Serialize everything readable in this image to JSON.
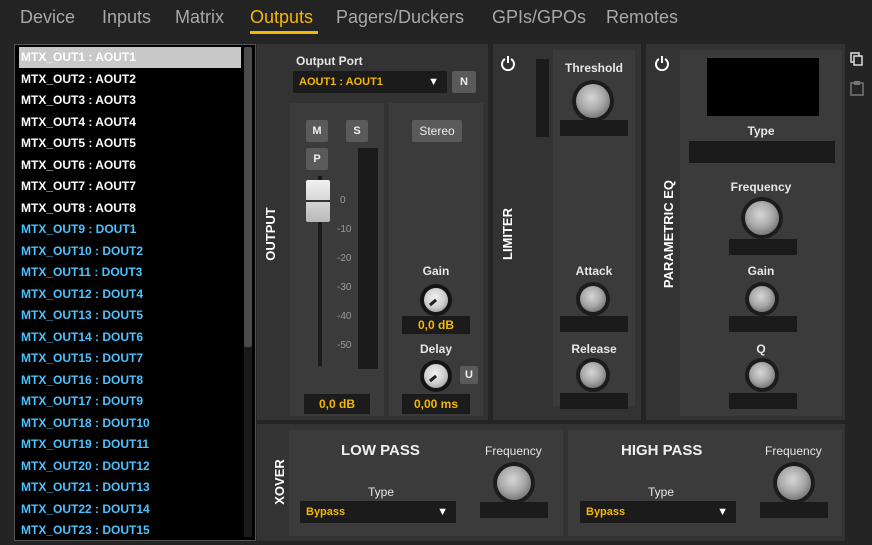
{
  "tabs": [
    {
      "label": "Device",
      "active": false
    },
    {
      "label": "Inputs",
      "active": false
    },
    {
      "label": "Matrix",
      "active": false
    },
    {
      "label": "Outputs",
      "active": true
    },
    {
      "label": "Pagers/Duckers",
      "active": false
    },
    {
      "label": "GPIs/GPOs",
      "active": false
    },
    {
      "label": "Remotes",
      "active": false
    }
  ],
  "colors": {
    "accent": "#f5b800",
    "digital": "#4cc2ff",
    "panel": "#333333"
  },
  "outputs": [
    {
      "label": "MTX_OUT1 : AOUT1",
      "kind": "analog",
      "selected": true
    },
    {
      "label": "MTX_OUT2 : AOUT2",
      "kind": "analog"
    },
    {
      "label": "MTX_OUT3 : AOUT3",
      "kind": "analog"
    },
    {
      "label": "MTX_OUT4 : AOUT4",
      "kind": "analog"
    },
    {
      "label": "MTX_OUT5 : AOUT5",
      "kind": "analog"
    },
    {
      "label": "MTX_OUT6 : AOUT6",
      "kind": "analog"
    },
    {
      "label": "MTX_OUT7 : AOUT7",
      "kind": "analog"
    },
    {
      "label": "MTX_OUT8 : AOUT8",
      "kind": "analog"
    },
    {
      "label": "MTX_OUT9 : DOUT1",
      "kind": "digital"
    },
    {
      "label": "MTX_OUT10 : DOUT2",
      "kind": "digital"
    },
    {
      "label": "MTX_OUT11 : DOUT3",
      "kind": "digital"
    },
    {
      "label": "MTX_OUT12 : DOUT4",
      "kind": "digital"
    },
    {
      "label": "MTX_OUT13 : DOUT5",
      "kind": "digital"
    },
    {
      "label": "MTX_OUT14 : DOUT6",
      "kind": "digital"
    },
    {
      "label": "MTX_OUT15 : DOUT7",
      "kind": "digital"
    },
    {
      "label": "MTX_OUT16 : DOUT8",
      "kind": "digital"
    },
    {
      "label": "MTX_OUT17 : DOUT9",
      "kind": "digital"
    },
    {
      "label": "MTX_OUT18 : DOUT10",
      "kind": "digital"
    },
    {
      "label": "MTX_OUT19 : DOUT11",
      "kind": "digital"
    },
    {
      "label": "MTX_OUT20 : DOUT12",
      "kind": "digital"
    },
    {
      "label": "MTX_OUT21 : DOUT13",
      "kind": "digital"
    },
    {
      "label": "MTX_OUT22 : DOUT14",
      "kind": "digital"
    },
    {
      "label": "MTX_OUT23 : DOUT15",
      "kind": "digital"
    }
  ],
  "output": {
    "section_label": "OUTPUT",
    "port_label": "Output Port",
    "port_value": "AOUT1 : AOUT1",
    "n_button": "N",
    "mute_button": "M",
    "solo_button": "S",
    "polarity_button": "P",
    "stereo_button": "Stereo",
    "fader_ticks": [
      "0",
      "-10",
      "-20",
      "-30",
      "-40",
      "-50"
    ],
    "fader_value": "0,0 dB",
    "gain_label": "Gain",
    "gain_value": "0,0 dB",
    "delay_label": "Delay",
    "delay_value": "0,00 ms",
    "u_button": "U"
  },
  "limiter": {
    "section_label": "LIMITER",
    "threshold_label": "Threshold",
    "attack_label": "Attack",
    "release_label": "Release"
  },
  "peq": {
    "section_label": "PARAMETRIC EQ",
    "type_label": "Type",
    "frequency_label": "Frequency",
    "gain_label": "Gain",
    "q_label": "Q"
  },
  "xover": {
    "section_label": "XOVER",
    "low_pass": {
      "title": "LOW PASS",
      "frequency_label": "Frequency",
      "type_label": "Type",
      "type_value": "Bypass"
    },
    "high_pass": {
      "title": "HIGH PASS",
      "frequency_label": "Frequency",
      "type_label": "Type",
      "type_value": "Bypass"
    }
  },
  "icons": {
    "power": "power-icon",
    "copy": "copy-icon",
    "paste": "paste-icon",
    "dropdown": "chevron-down-icon"
  }
}
